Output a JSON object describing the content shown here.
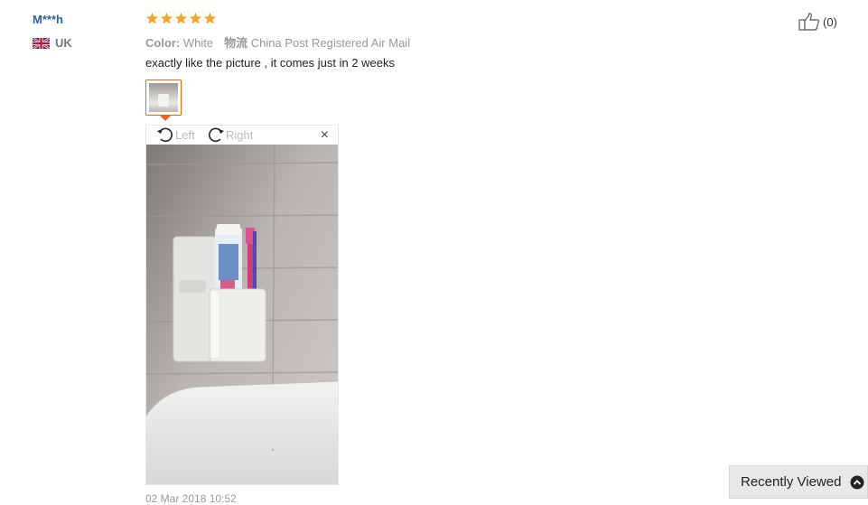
{
  "reviewer": {
    "name": "M***h",
    "country": "UK",
    "flag_icon": "uk-flag-icon"
  },
  "rating": {
    "stars": 5,
    "max": 5,
    "color": "#f5a623"
  },
  "meta": {
    "color_key": "Color:",
    "color_value": "White",
    "shipping_key": "物流",
    "shipping_value": "China Post Registered Air Mail"
  },
  "review": {
    "text": "exactly like the picture , it comes just in 2 weeks",
    "date_partial": "02 Mar 2018 10:52"
  },
  "viewer": {
    "rotate_left_label": "Left",
    "rotate_right_label": "Right",
    "rotate_left_icon": "rotate-left-icon",
    "rotate_right_icon": "rotate-right-icon",
    "close_label": "×",
    "close_icon": "close-icon"
  },
  "helpful": {
    "count_label": "(0)",
    "icon": "thumbs-up-icon"
  },
  "recently_viewed": {
    "label": "Recently Viewed",
    "icon": "chevron-up-circle-icon"
  },
  "colors": {
    "username": "#2b62a8",
    "accent": "#e46b10",
    "star": "#f5a623"
  }
}
